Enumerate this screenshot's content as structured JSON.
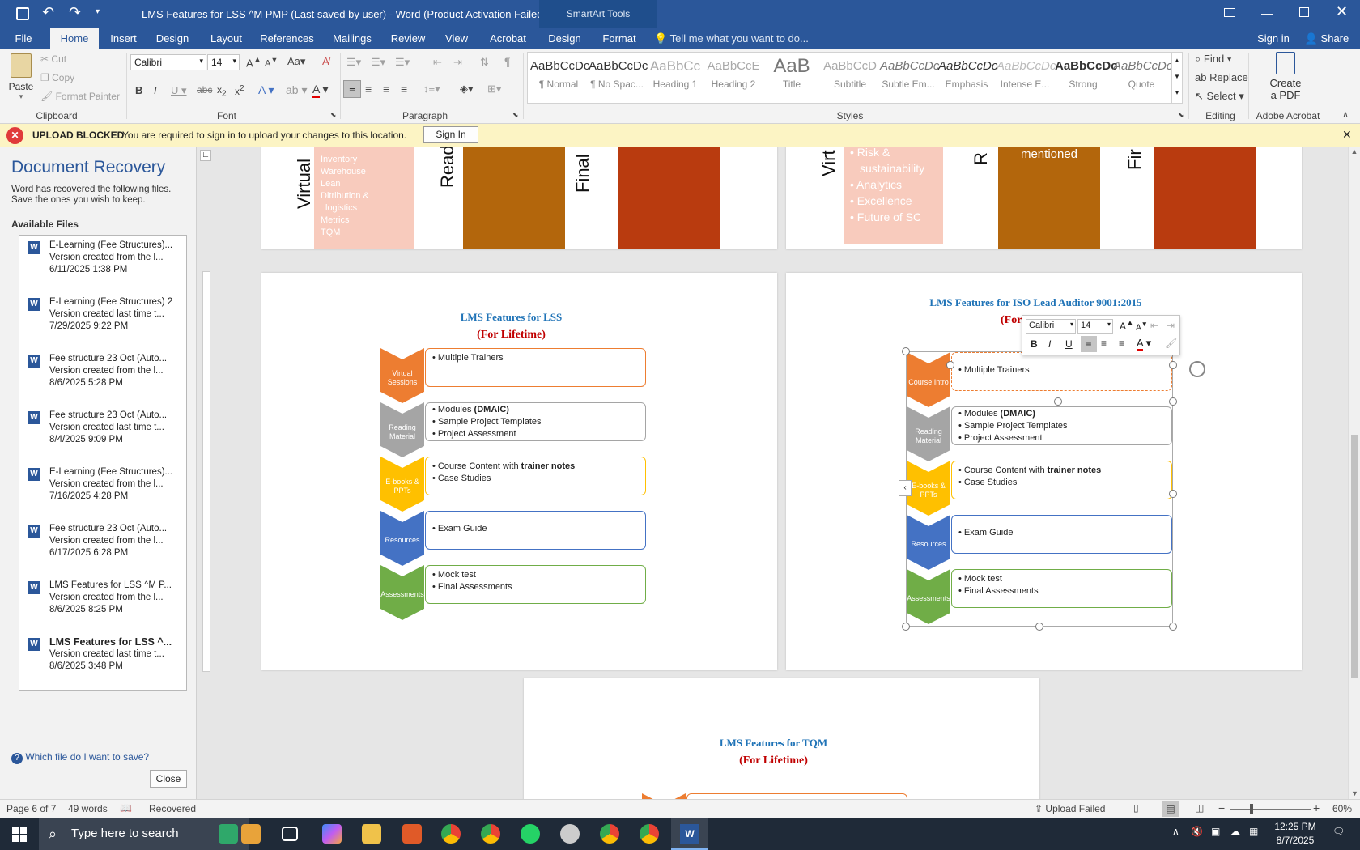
{
  "window": {
    "title": "LMS Features for LSS ^M PMP (Last saved by user) - Word (Product Activation Failed)",
    "smartart_tools": "SmartArt Tools",
    "sign_in": "Sign in",
    "share": "Share"
  },
  "tabs": [
    "File",
    "Home",
    "Insert",
    "Design",
    "Layout",
    "References",
    "Mailings",
    "Review",
    "View",
    "Acrobat",
    "Design",
    "Format"
  ],
  "tell_me": "Tell me what you want to do...",
  "ribbon": {
    "clipboard": {
      "paste": "Paste",
      "cut": "Cut",
      "copy": "Copy",
      "format_painter": "Format Painter",
      "label": "Clipboard"
    },
    "font": {
      "name": "Calibri",
      "size": "14",
      "label": "Font"
    },
    "paragraph": {
      "label": "Paragraph"
    },
    "styles": {
      "label": "Styles",
      "items": [
        {
          "preview": "AaBbCcDc",
          "name": "¶ Normal"
        },
        {
          "preview": "AaBbCcDc",
          "name": "¶ No Spac..."
        },
        {
          "preview": "AaBbCc",
          "name": "Heading 1"
        },
        {
          "preview": "AaBbCcE",
          "name": "Heading 2"
        },
        {
          "preview": "AaB",
          "name": "Title"
        },
        {
          "preview": "AaBbCcD",
          "name": "Subtitle"
        },
        {
          "preview": "AaBbCcDc",
          "name": "Subtle Em..."
        },
        {
          "preview": "AaBbCcDc",
          "name": "Emphasis"
        },
        {
          "preview": "AaBbCcDc",
          "name": "Intense E..."
        },
        {
          "preview": "AaBbCcDc",
          "name": "Strong"
        },
        {
          "preview": "AaBbCcDc",
          "name": "Quote"
        }
      ]
    },
    "editing": {
      "find": "Find",
      "replace": "Replace",
      "select": "Select",
      "label": "Editing"
    },
    "acrobat": {
      "create": "Create",
      "pdf": "a PDF",
      "label": "Adobe Acrobat"
    }
  },
  "message_bar": {
    "title": "UPLOAD BLOCKED",
    "text": "You are required to sign in to upload your changes to this location.",
    "button": "Sign In"
  },
  "recovery": {
    "title": "Document Recovery",
    "desc1": "Word has recovered the following files.",
    "desc2": "Save the ones you wish to keep.",
    "available": "Available Files",
    "files": [
      {
        "name": "E-Learning (Fee Structures)...",
        "desc": "Version created from the l...",
        "date": "6/11/2025 1:38 PM"
      },
      {
        "name": "E-Learning (Fee Structures) 2",
        "desc": "Version created last time t...",
        "date": "7/29/2025 9:22 PM"
      },
      {
        "name": "Fee structure 23 Oct (Auto...",
        "desc": "Version created from the l...",
        "date": "8/6/2025 5:28 PM"
      },
      {
        "name": "Fee structure 23 Oct (Auto...",
        "desc": "Version created last time t...",
        "date": "8/4/2025 9:09 PM"
      },
      {
        "name": "E-Learning (Fee Structures)...",
        "desc": "Version created from the l...",
        "date": "7/16/2025 4:28 PM"
      },
      {
        "name": "Fee structure 23 Oct (Auto...",
        "desc": "Version created from the l...",
        "date": "6/17/2025 6:28 PM"
      },
      {
        "name": "LMS Features for LSS ^M P...",
        "desc": "Version created from the l...",
        "date": "8/6/2025 8:25 PM"
      },
      {
        "name": "LMS Features for LSS ^... ",
        "desc": "Version created last time t...",
        "date": "8/6/2025 3:48 PM"
      }
    ],
    "help": "Which file do I want to save?",
    "close": "Close"
  },
  "doc": {
    "top_left": {
      "v1": "Virtual",
      "v2": "Read",
      "v3": "Final",
      "items": [
        "Inventory",
        "Warehouse",
        "Lean",
        "Ditribution &",
        "logistics",
        "Metrics",
        "TQM"
      ]
    },
    "top_right": {
      "v1": "Virt",
      "v2": "R",
      "v3": "Fir",
      "items": [
        "Risk &",
        "sustainability",
        "Analytics",
        "Excellence",
        "Future of SC"
      ],
      "mentioned": "mentioned"
    },
    "lss": {
      "title": "LMS Features for LSS",
      "subtitle": "(For Lifetime)"
    },
    "iso": {
      "title": "LMS Features for ISO Lead Auditor 9001:2015",
      "subtitle_visible": "(For"
    },
    "tqm": {
      "title": "LMS Features for TQM",
      "subtitle": "(For Lifetime)"
    },
    "steps_lss": [
      {
        "label1": "Virtual",
        "label2": "Sessions",
        "lines": [
          "• Multiple Trainers"
        ],
        "bold": ""
      },
      {
        "label1": "Reading",
        "label2": "Material",
        "lines": [
          "• Modules ",
          "• Sample Project Templates",
          "• Project Assessment"
        ],
        "bold": "(DMAIC)"
      },
      {
        "label1": "E-books &",
        "label2": "PPTs",
        "lines": [
          "• Course Content with ",
          "• Case Studies"
        ],
        "bold": "trainer notes"
      },
      {
        "label1": "Resources",
        "label2": "",
        "lines": [
          "• Exam Guide"
        ],
        "bold": ""
      },
      {
        "label1": "Assessments",
        "label2": "",
        "lines": [
          "• Mock test",
          "• Final Assessments"
        ],
        "bold": ""
      }
    ],
    "steps_iso": [
      {
        "label1": "Course Intro",
        "label2": "",
        "lines": [
          "• Multiple Trainers"
        ],
        "bold": ""
      },
      {
        "label1": "Reading",
        "label2": "Material",
        "lines": [
          "• Modules ",
          "• Sample Project Templates",
          "• Project Assessment"
        ],
        "bold": "(DMAIC)"
      },
      {
        "label1": "E-books &",
        "label2": "PPTs",
        "lines": [
          "• Course Content with ",
          "• Case Studies"
        ],
        "bold": "trainer notes"
      },
      {
        "label1": "Resources",
        "label2": "",
        "lines": [
          "• Exam Guide"
        ],
        "bold": ""
      },
      {
        "label1": "Assessments",
        "label2": "",
        "lines": [
          "• Mock test",
          "• Final Assessments"
        ],
        "bold": ""
      }
    ],
    "mini_toolbar": {
      "font": "Calibri",
      "size": "14"
    }
  },
  "status": {
    "page": "Page 6 of 7",
    "words": "49 words",
    "recovered": "Recovered",
    "upload": "Upload Failed",
    "zoom": "60%"
  },
  "taskbar": {
    "search": "Type here to search",
    "time": "12:25 PM",
    "date": "8/7/2025"
  },
  "colors": {
    "orange": "#ed7d31",
    "gray": "#a5a5a5",
    "gold": "#ffc000",
    "blue": "#4472c4",
    "green": "#70ad47",
    "word_blue": "#2b579a"
  }
}
